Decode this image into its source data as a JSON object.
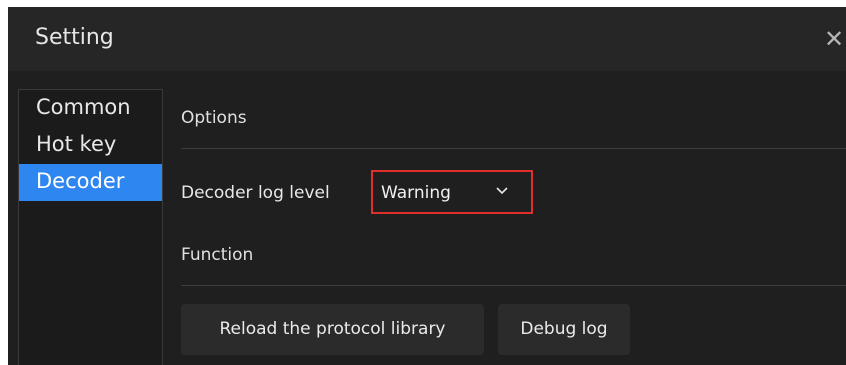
{
  "dialog": {
    "title": "Setting",
    "close_icon": "close-icon"
  },
  "sidebar": {
    "items": [
      {
        "label": "Common",
        "active": false
      },
      {
        "label": "Hot key",
        "active": false
      },
      {
        "label": "Decoder",
        "active": true
      }
    ]
  },
  "options": {
    "section_title": "Options",
    "decoder_log_level": {
      "label": "Decoder log level",
      "value": "Warning",
      "icon": "chevron-down-icon"
    }
  },
  "function": {
    "section_title": "Function",
    "reload_button_label": "Reload the protocol library",
    "debug_log_button_label": "Debug log"
  },
  "colors": {
    "selected_item": "#2e86f0",
    "highlight_border": "#e0302b",
    "background": "#1f1f1f"
  }
}
